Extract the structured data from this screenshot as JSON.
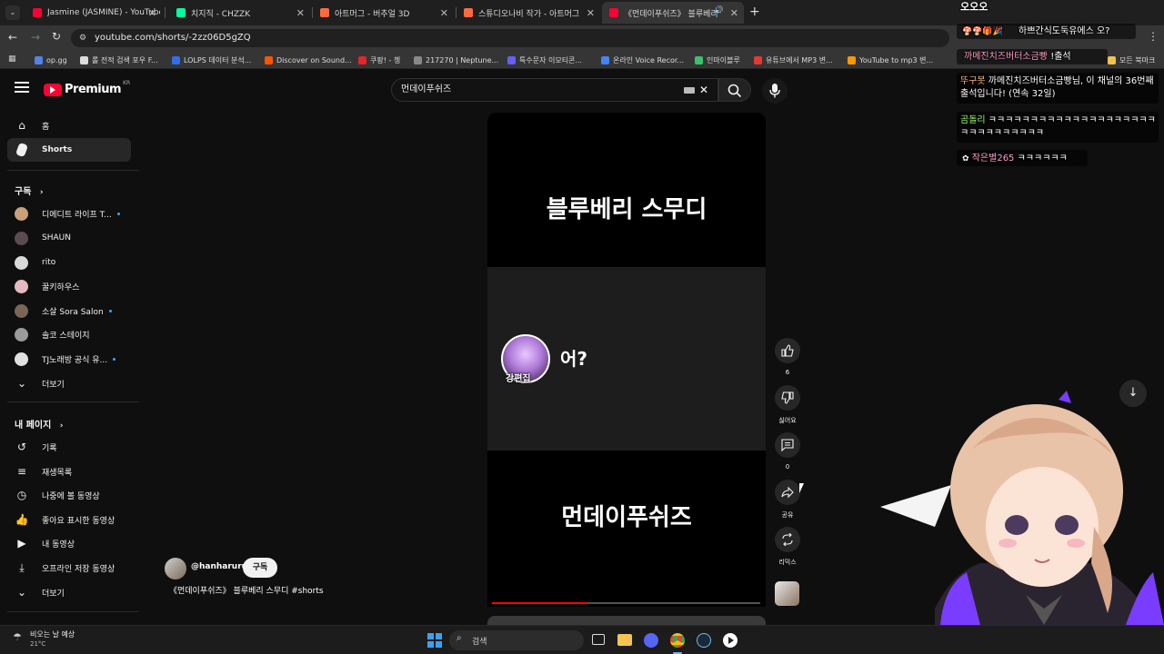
{
  "tabs": [
    {
      "label": "Jasmine (JASMINE) - YouTube",
      "color": "#ff0033",
      "active": false
    },
    {
      "label": "치지직 - CHZZK",
      "color": "#00ffa3",
      "active": false
    },
    {
      "label": "아트머그 - 버추얼 3D",
      "color": "#ff6a3d",
      "active": false
    },
    {
      "label": "스튜디오나비 작가 - 아트머그",
      "color": "#ff6a3d",
      "active": false
    },
    {
      "label": "《먼데이푸쉬즈》 블루베리",
      "color": "#ff0033",
      "active": true
    }
  ],
  "url": "youtube.com/shorts/-2zz06D5gZQ",
  "bookmarks": [
    {
      "label": "op.gg",
      "color": "#5383e8"
    },
    {
      "label": "롤 전적 검색 포우 F...",
      "color": "#dddddd"
    },
    {
      "label": "LOLPS 데이터 분석...",
      "color": "#2f6fed"
    },
    {
      "label": "Discover on Sound...",
      "color": "#ff5500"
    },
    {
      "label": "쿠팡! - 쳉",
      "color": "#e52528"
    },
    {
      "label": "217270 | Neptune...",
      "color": "#888888"
    },
    {
      "label": "특수문자 이모티콘...",
      "color": "#6b5cff"
    },
    {
      "label": "온라인 Voice Recor...",
      "color": "#4285f4"
    },
    {
      "label": "인마이블루",
      "color": "#39c16c"
    },
    {
      "label": "유튜브에서 MP3 변...",
      "color": "#e53935"
    },
    {
      "label": "YouTube to mp3 변...",
      "color": "#ff9800"
    },
    {
      "label": "모든 북마크",
      "color": "#f2c14e"
    }
  ],
  "yt": {
    "logo": "Premium",
    "region": "KR",
    "search_value": "먼데이푸쉬즈"
  },
  "sidebar": {
    "main": [
      {
        "label": "홈",
        "icon": "home-icon"
      },
      {
        "label": "Shorts",
        "icon": "shorts-icon"
      }
    ],
    "subs_header": "구독",
    "subs": [
      {
        "label": "디에디트 라이프 T...",
        "color": "#caa07a",
        "dot": true
      },
      {
        "label": "SHAUN",
        "color": "#5a4b52",
        "dot": false
      },
      {
        "label": "rito",
        "color": "#d9d9d9",
        "dot": false
      },
      {
        "label": "꿀키하우스",
        "color": "#e6b8c2",
        "dot": false
      },
      {
        "label": "소살 Sora Salon",
        "color": "#7b6656",
        "dot": true
      },
      {
        "label": "솔코 스테이지",
        "color": "#9a9a9a",
        "dot": false
      },
      {
        "label": "TJ노래방 공식 유...",
        "color": "#e0e0e0",
        "dot": true
      }
    ],
    "subs_more": "더보기",
    "me_header": "내 페이지",
    "me": [
      {
        "label": "기록",
        "icon": "history-icon"
      },
      {
        "label": "재생목록",
        "icon": "playlist-icon"
      },
      {
        "label": "나중에 볼 동영상",
        "icon": "clock-icon"
      },
      {
        "label": "좋아요 표시한 동영상",
        "icon": "thumb-up-icon"
      },
      {
        "label": "내 동영상",
        "icon": "video-icon"
      },
      {
        "label": "오프라인 저장 동영상",
        "icon": "download-icon"
      }
    ],
    "me_more": "더보기"
  },
  "short": {
    "top_text": "블루베리 스무디",
    "mid_text": "어?",
    "avatar_caption": "강편집",
    "bottom_text": "먼데이푸쉬즈",
    "progress": 0.36,
    "channel": "@hanharuru",
    "subscribe": "구독",
    "title": "《먼데이푸쉬즈》 블루베리 스무디 #shorts"
  },
  "actions": {
    "like_count": "6",
    "dislike_label": "싫어요",
    "comment_count": "0",
    "share_label": "공유",
    "remix_label": "리믹스"
  },
  "chat": {
    "header": "오오오",
    "line1": "하쁘간식도둑유에스 오?",
    "line2_name": "까메진치즈버터소금빵",
    "line2_text": "!출석",
    "line3_name": "뚜구봇",
    "line3_text": "까메진치즈버터소금빵님, 이 채널의 36번째 출석입니다! (연속 32일)",
    "line4_name": "곰돌리",
    "line4_text": "ㅋㅋㅋㅋㅋㅋㅋㅋㅋㅋㅋㅋㅋㅋㅋㅋㅋㅋㅋㅋㅋㅋㅋㅋㅋㅋㅋㅋㅋㅋ",
    "line5_name": "작은별265",
    "line5_text": "ㅋㅋㅋㅋㅋㅋ"
  },
  "taskbar": {
    "weather_title": "비오는 날 예상",
    "weather_temp": "21°C",
    "search_label": "검색"
  }
}
